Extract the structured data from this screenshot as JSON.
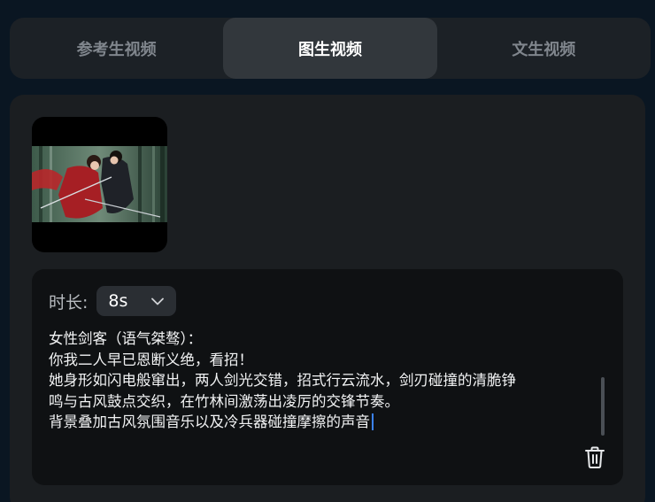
{
  "tabs": [
    {
      "label": "参考生视频",
      "active": false
    },
    {
      "label": "图生视频",
      "active": true
    },
    {
      "label": "文生视频",
      "active": false
    }
  ],
  "upload": {
    "thumbnail": "anime-style image of two sword fighters in a bamboo forest"
  },
  "prompt": {
    "duration_label": "时长:",
    "duration_value": "8s",
    "text": "女性剑客（语气桀骜）：\n你我二人早已恩断义绝，看招！\n她身形如闪电般窜出，两人剑光交错，招式行云流水，剑刃碰撞的清脆铮\n鸣与古风鼓点交织，在竹林间激荡出凌厉的交锋节奏。\n背景叠加古风氛围音乐以及冷兵器碰撞摩擦的声音"
  },
  "icons": {
    "dropdown": "chevron-down-icon",
    "delete": "trash-icon"
  },
  "colors": {
    "background": "#0a1622",
    "tab_active": "#32373c",
    "caret": "#3b82f6"
  }
}
